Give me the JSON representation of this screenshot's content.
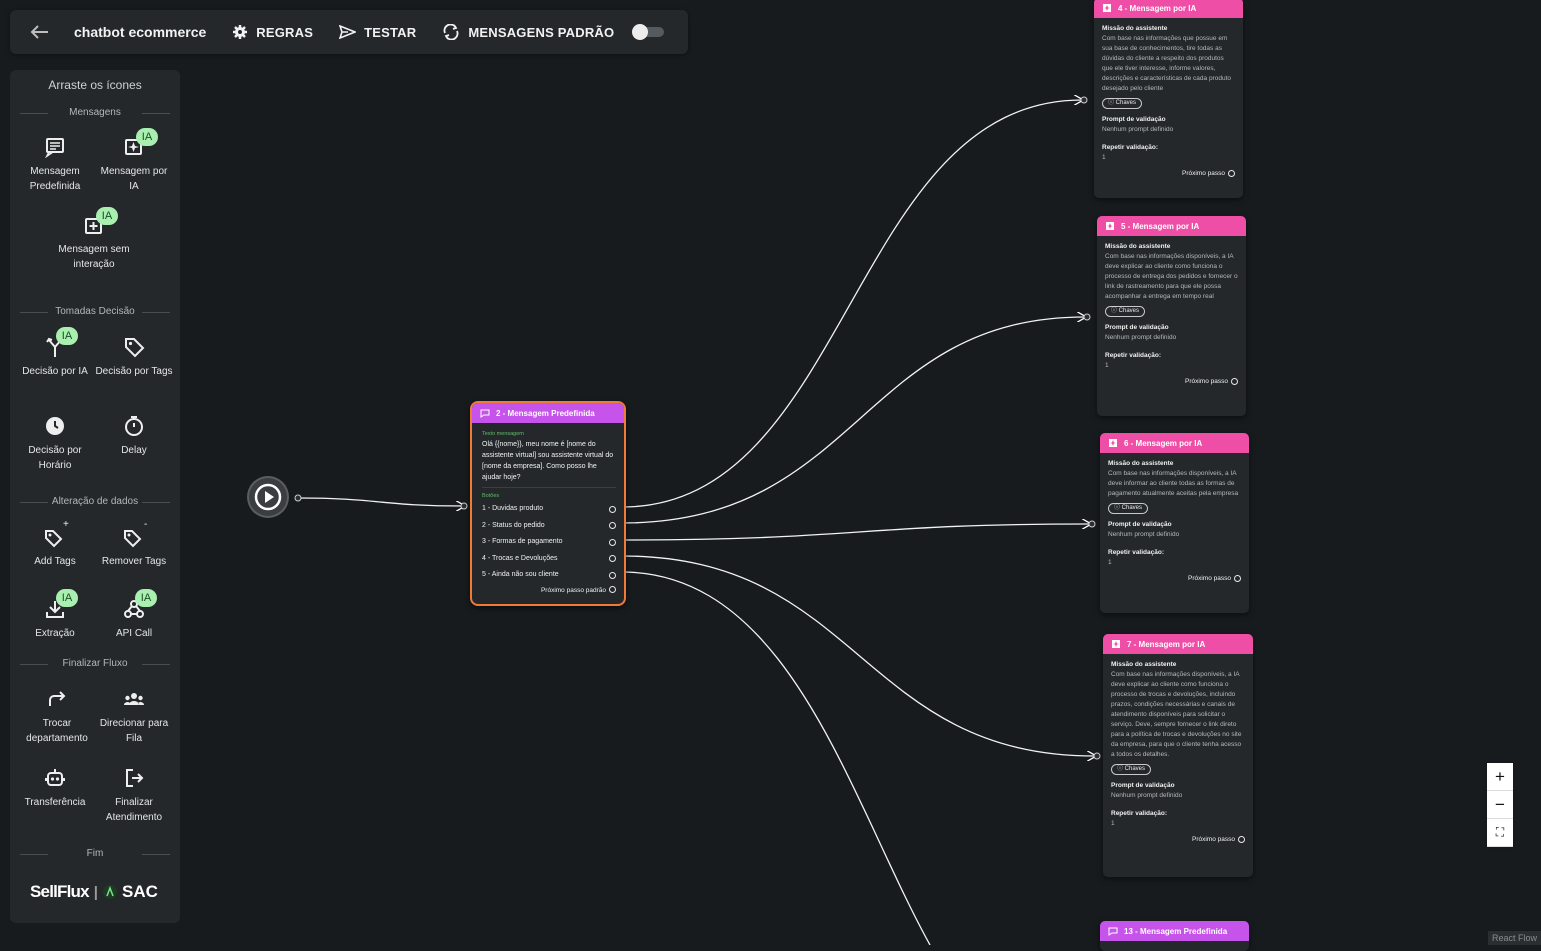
{
  "toolbar": {
    "title": "chatbot ecommerce",
    "rules_label": "REGRAS",
    "test_label": "TESTAR",
    "default_messages_label": "MENSAGENS PADRÃO",
    "default_messages_enabled": false
  },
  "sidebar": {
    "title": "Arraste os ícones",
    "sections": {
      "messages": "Mensagens",
      "decisions": "Tomadas Decisão",
      "data": "Alteração de dados",
      "finish": "Finalizar Fluxo",
      "end": "Fim"
    },
    "items": {
      "predefined": "Mensagem Predefinida",
      "ai_message": "Mensagem por IA",
      "no_interaction": "Mensagem sem interação",
      "ai_decision": "Decisão por IA",
      "tag_decision": "Decisão por Tags",
      "time_decision": "Decisão por Horário",
      "delay": "Delay",
      "add_tags": "Add Tags",
      "remove_tags": "Remover Tags",
      "extraction": "Extração",
      "api_call": "API Call",
      "switch_department": "Trocar departamento",
      "queue": "Direcionar para Fila",
      "transfer": "Transferência",
      "finish_service": "Finalizar Atendimento"
    },
    "badge": "IA",
    "add_sign": "+",
    "remove_sign": "-",
    "brand": {
      "sellflux": "SellFlux",
      "separator": "|",
      "sac": "SAC"
    }
  },
  "labels": {
    "mission": "Missão do assistente",
    "keys": "Chaves",
    "validation_prompt": "Prompt de validação",
    "no_prompt": "Nenhum prompt definido",
    "repeat_validation": "Repetir validação:",
    "next_step": "Próximo passo",
    "default_next_step": "Próximo passo padrão",
    "message_text": "Texto mensagem",
    "buttons": "Botões"
  },
  "nodes": {
    "n2": {
      "title": "2 - Mensagem Predefinida",
      "text": "Olá {{nome}}, meu nome é [nome do assistente virtual] sou assistente virtual do [nome da empresa]. Como posso lhe ajudar hoje?",
      "buttons": [
        "1 - Duvidas produto",
        "2 - Status do pedido",
        "3 - Formas de pagamento",
        "4 - Trocas e Devoluções",
        "5 - Ainda não sou cliente"
      ]
    },
    "n4": {
      "title": "4 - Mensagem por IA",
      "mission": "Com base nas informações que possue em sua base de conhecimentos, tire todas as dúvidas do cliente a respeito dos produtos que ele tiver interesse, informe valores, descrições e características de cada produto desejado pelo cliente",
      "repeat": "1"
    },
    "n5": {
      "title": "5 - Mensagem por IA",
      "mission": "Com base nas informações disponíveis, a IA deve explicar ao cliente como funciona o processo de entrega dos pedidos e fornecer o link de rastreamento para que ele possa acompanhar a entrega em tempo real",
      "repeat": "1"
    },
    "n6": {
      "title": "6 - Mensagem por IA",
      "mission": "Com base nas informações disponíveis, a IA deve informar ao cliente todas as formas de pagamento atualmente aceitas pela empresa",
      "repeat": "1"
    },
    "n7": {
      "title": "7 - Mensagem por IA",
      "mission": "Com base nas informações disponíveis, a IA deve explicar ao cliente como funciona o processo de trocas e devoluções, incluindo prazos, condições necessárias e canais de atendimento disponíveis para solicitar o serviço. Deve, sempre fornecer o link direto para a política de trocas e devoluções no site da empresa, para que o cliente tenha acesso a todos os detalhes.",
      "repeat": "1"
    },
    "n13": {
      "title": "13 - Mensagem Predefinida"
    }
  },
  "zoom": {
    "in": "+",
    "out": "−",
    "fit": "⛶"
  },
  "attribution": "React Flow",
  "colors": {
    "ai_header": "#ef4ea6",
    "predefined_header": "#c654ea",
    "selected_border": "#f07a37",
    "badge": "#a8efb0"
  }
}
